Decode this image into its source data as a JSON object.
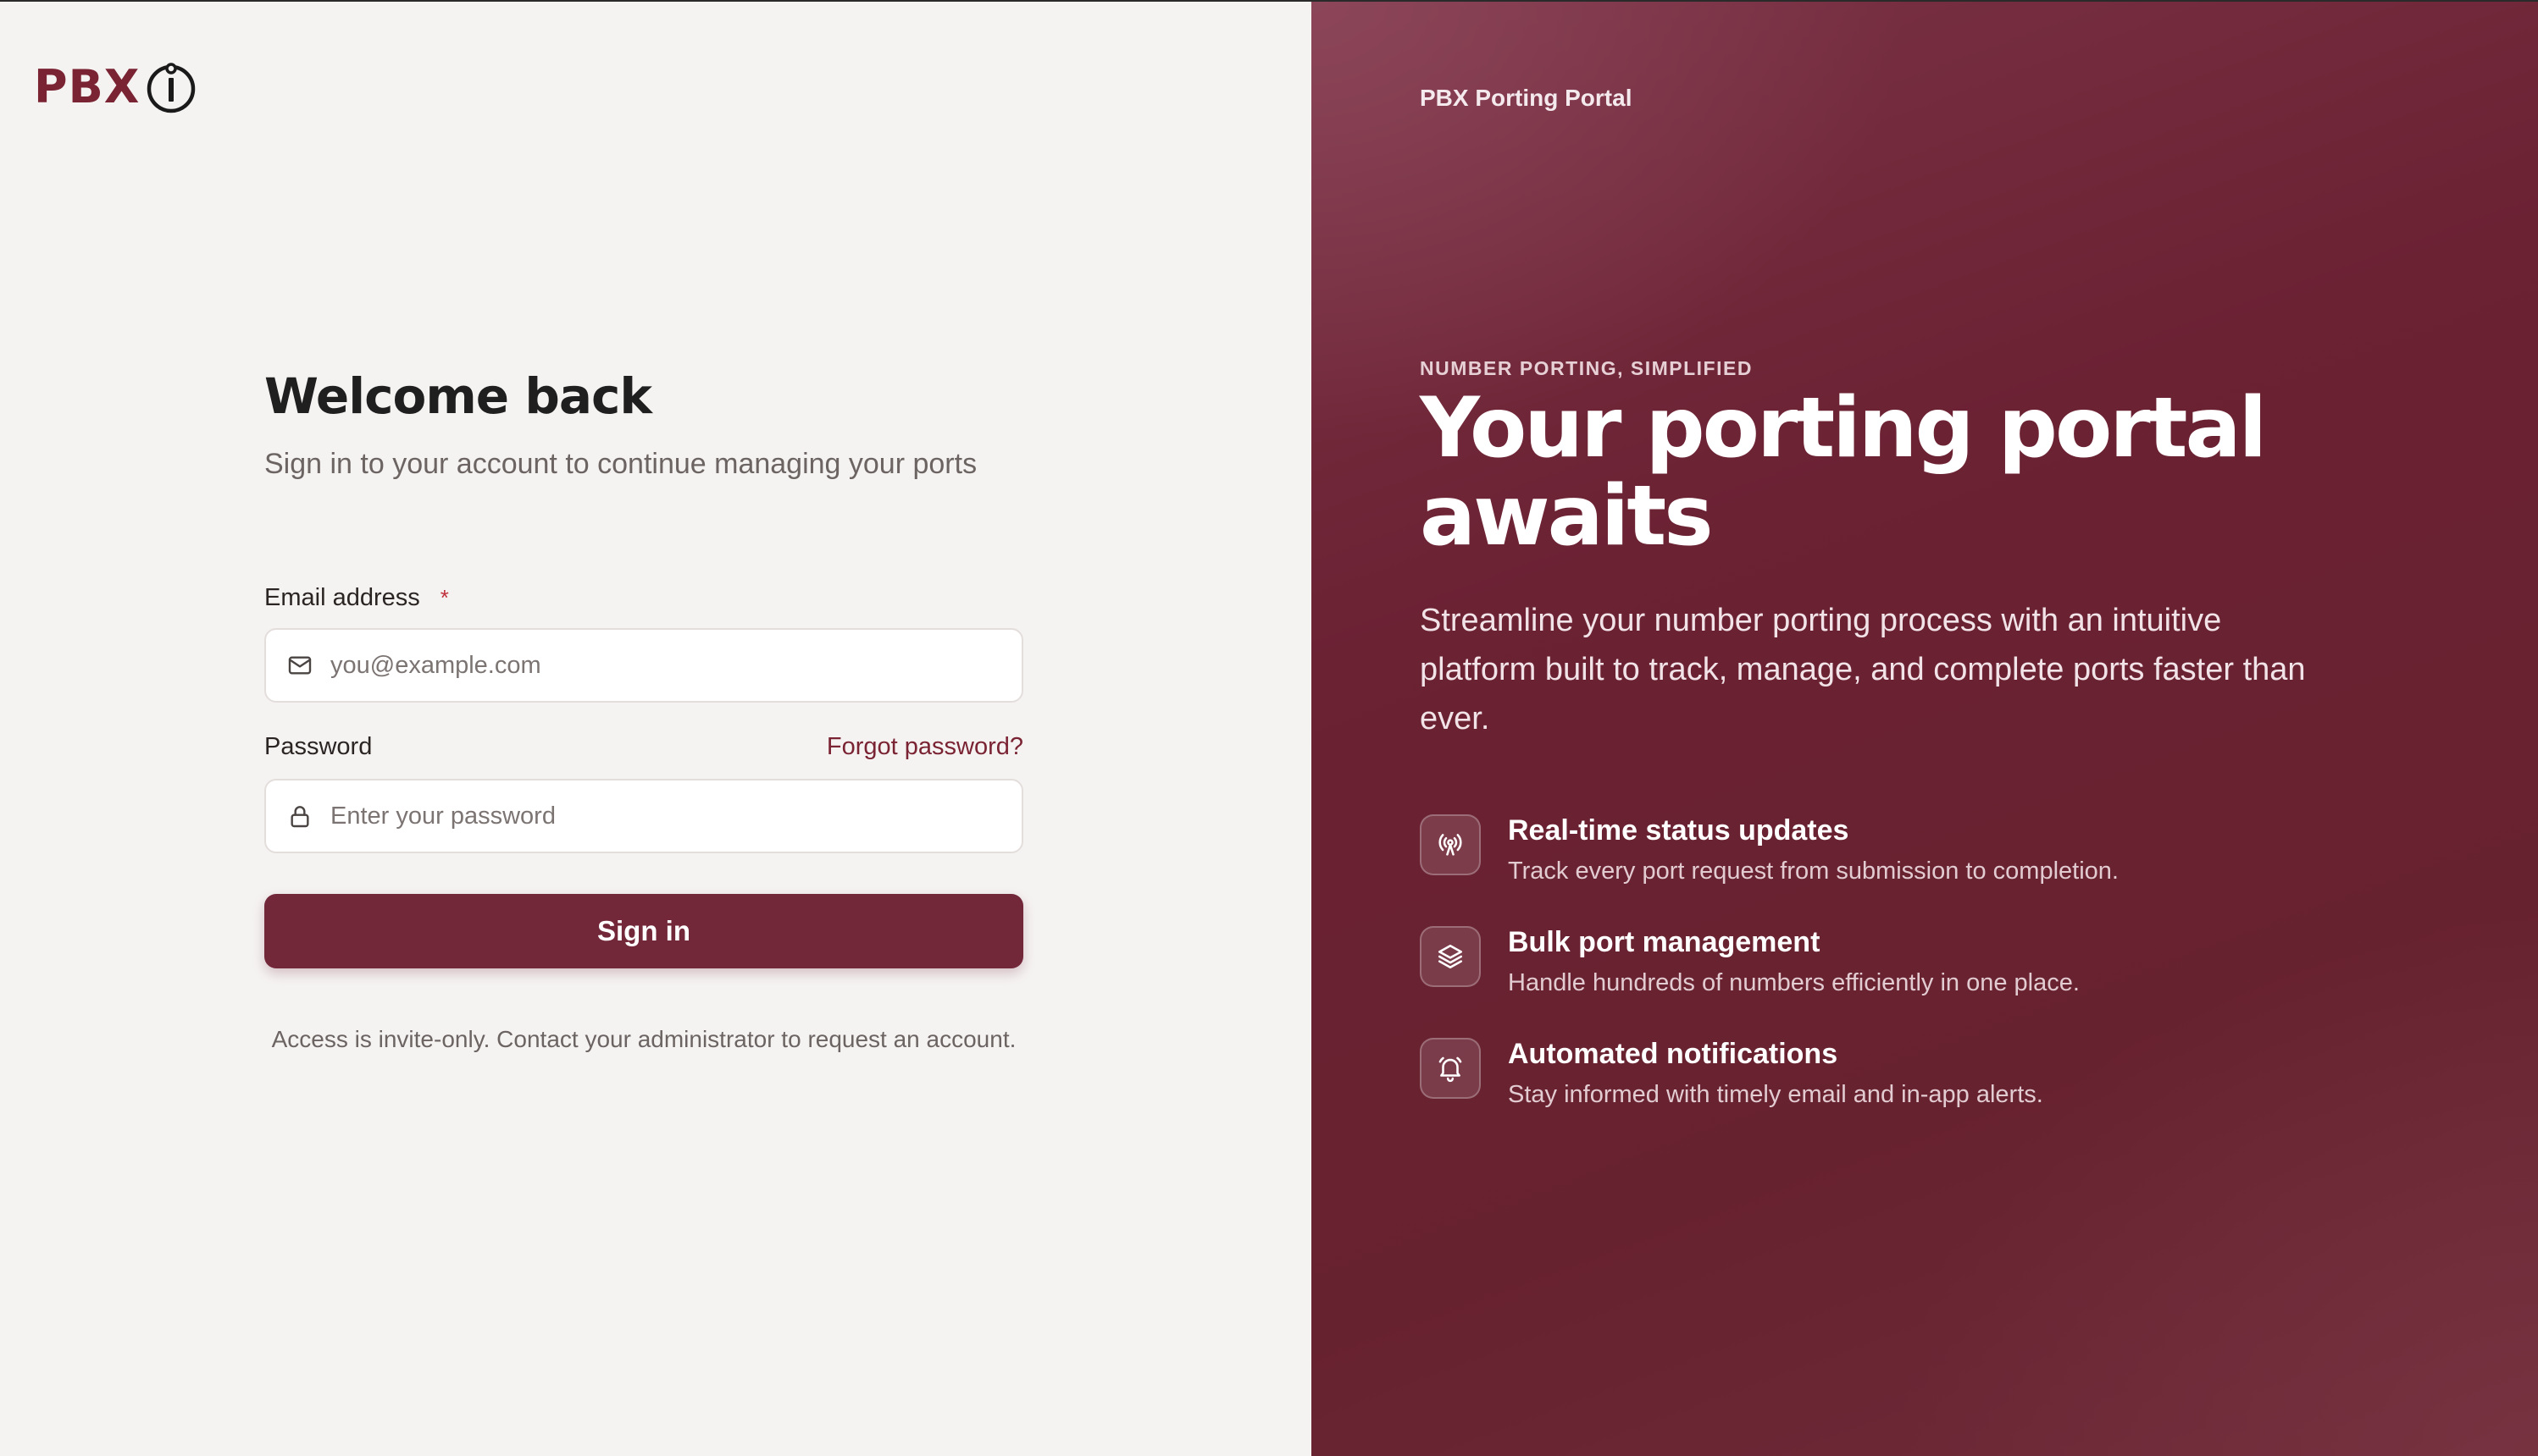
{
  "brand": {
    "logo_text": "PBX",
    "logo_mark": "info-circle-logo-mark",
    "color": "#7a2333"
  },
  "signin": {
    "title": "Welcome back",
    "subtitle": "Sign in to your account to continue managing your ports",
    "email": {
      "label": "Email address",
      "required_mark": "*",
      "placeholder": "you@example.com",
      "value": "",
      "icon": "mail-icon"
    },
    "password": {
      "label": "Password",
      "forgot_label": "Forgot password?",
      "placeholder": "Enter your password",
      "value": "",
      "icon": "lock-icon"
    },
    "submit_label": "Sign in",
    "note": "Access is invite-only. Contact your administrator to request an account."
  },
  "promo": {
    "portal_name": "PBX Porting Portal",
    "eyebrow": "NUMBER PORTING, SIMPLIFIED",
    "headline": "Your porting portal awaits",
    "description": "Streamline your number porting process with an intuitive platform built to track, manage, and complete ports faster than ever.",
    "features": [
      {
        "icon": "broadcast-icon",
        "title": "Real-time status updates",
        "description": "Track every port request from submission to completion."
      },
      {
        "icon": "layers-icon",
        "title": "Bulk port management",
        "description": "Handle hundreds of numbers efficiently in one place."
      },
      {
        "icon": "bell-icon",
        "title": "Automated notifications",
        "description": "Stay informed with timely email and in-app alerts."
      }
    ]
  },
  "colors": {
    "accent": "#73283a",
    "panel_bg": "#6b2233",
    "page_bg": "#f5f3f2",
    "required": "#c0303c"
  }
}
